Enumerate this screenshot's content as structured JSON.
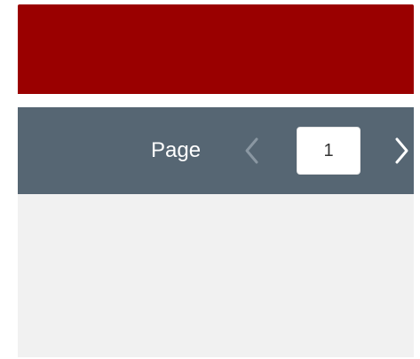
{
  "pager": {
    "label": "Page",
    "current_page": "1",
    "prev_icon": "chevron-left-icon",
    "next_icon": "chevron-right-icon"
  },
  "colors": {
    "banner": "#9a0000",
    "pager_bar": "#566673",
    "content_bg": "#f1f1f1",
    "prev_chevron": "#8a97a2",
    "next_chevron": "#ffffff"
  }
}
